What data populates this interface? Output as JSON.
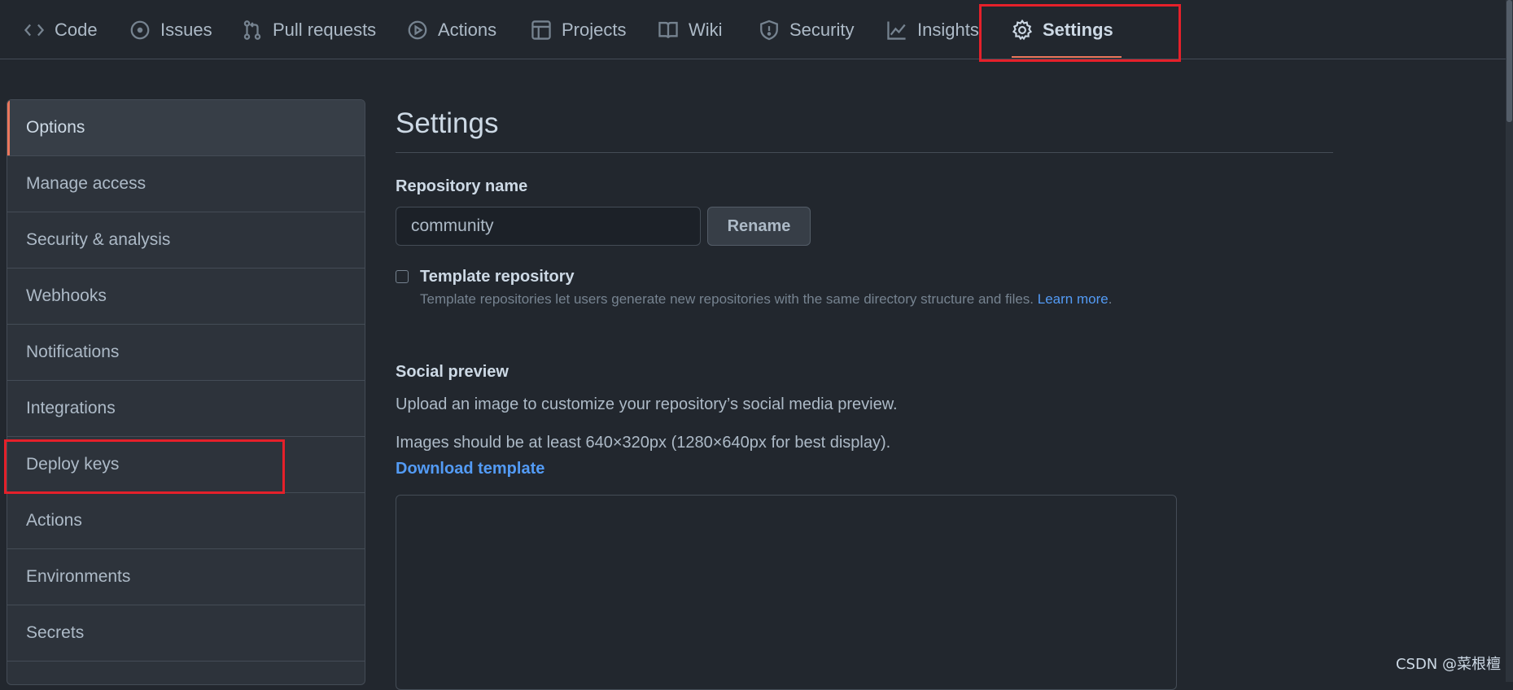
{
  "repo_nav": {
    "tabs": [
      {
        "label": "Code",
        "icon": "code-icon"
      },
      {
        "label": "Issues",
        "icon": "issue-opened-icon"
      },
      {
        "label": "Pull requests",
        "icon": "git-pull-request-icon"
      },
      {
        "label": "Actions",
        "icon": "play-icon"
      },
      {
        "label": "Projects",
        "icon": "project-icon"
      },
      {
        "label": "Wiki",
        "icon": "book-icon"
      },
      {
        "label": "Security",
        "icon": "shield-icon"
      },
      {
        "label": "Insights",
        "icon": "graph-icon"
      },
      {
        "label": "Settings",
        "icon": "gear-icon",
        "selected": true
      }
    ]
  },
  "sidebar": {
    "items": [
      {
        "label": "Options",
        "selected": true
      },
      {
        "label": "Manage access"
      },
      {
        "label": "Security & analysis"
      },
      {
        "label": "Webhooks"
      },
      {
        "label": "Notifications"
      },
      {
        "label": "Integrations"
      },
      {
        "label": "Deploy keys",
        "highlighted": true
      },
      {
        "label": "Actions"
      },
      {
        "label": "Environments"
      },
      {
        "label": "Secrets"
      }
    ]
  },
  "main": {
    "title": "Settings",
    "repo_name": {
      "label": "Repository name",
      "value": "community",
      "rename_label": "Rename"
    },
    "template_repo": {
      "label": "Template repository",
      "checked": false,
      "note": "Template repositories let users generate new repositories with the same directory structure and files.",
      "learn_more": "Learn more",
      "period": "."
    },
    "social_preview": {
      "label": "Social preview",
      "description": "Upload an image to customize your repository’s social media preview.",
      "size_hint": "Images should be at least 640×320px (1280×640px for best display).",
      "download_label": "Download template"
    }
  },
  "watermark": "CSDN @菜根檀",
  "colors": {
    "background": "#22272e",
    "sidebar_bg": "#2d333b",
    "accent": "#ec775c",
    "link": "#539bf5",
    "highlight": "#e5202a"
  }
}
